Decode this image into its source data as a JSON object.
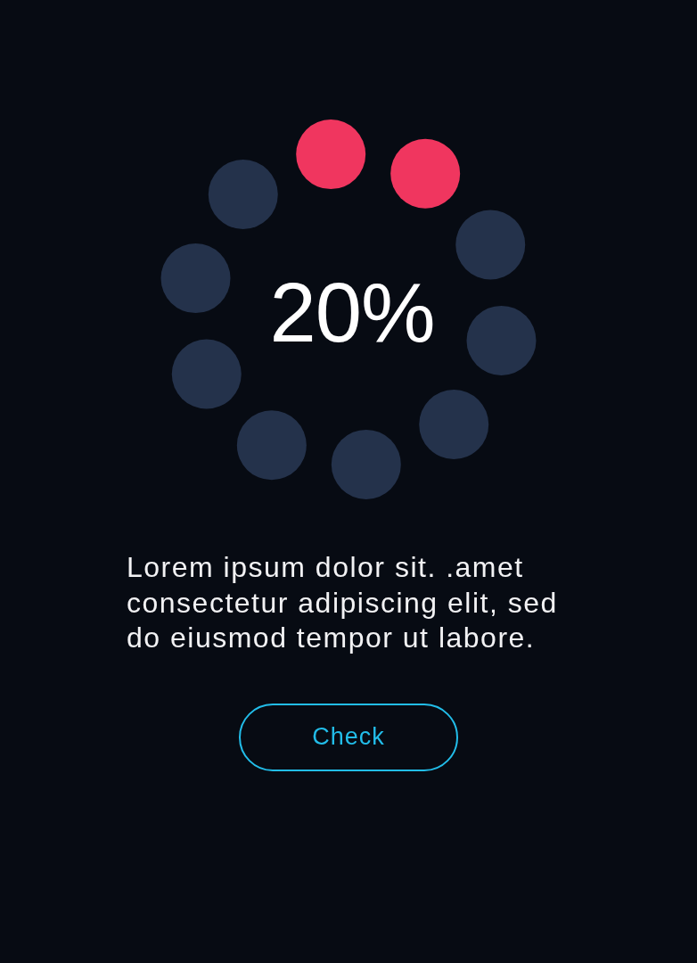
{
  "loader": {
    "percent": "20%",
    "dots": [
      {
        "filled": true
      },
      {
        "filled": true
      },
      {
        "filled": false
      },
      {
        "filled": false
      },
      {
        "filled": false
      },
      {
        "filled": false
      },
      {
        "filled": false
      },
      {
        "filled": false
      },
      {
        "filled": false
      },
      {
        "filled": false
      }
    ]
  },
  "message": "Lorem ipsum dolor sit. .amet consectetur adipiscing elit, sed do eiusmod tempor ut labore.",
  "button": {
    "label": "Check"
  }
}
